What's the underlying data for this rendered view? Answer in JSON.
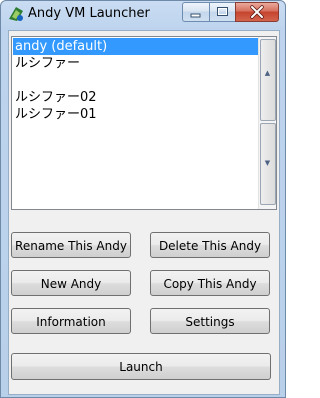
{
  "window": {
    "title": "Andy VM Launcher",
    "icon": "andy-app-icon"
  },
  "caption_buttons": {
    "minimize_icon": "minimize-icon",
    "maximize_icon": "maximize-icon",
    "close_icon": "close-icon"
  },
  "vm_list": {
    "items": [
      {
        "label": "andy (default)",
        "selected": true
      },
      {
        "label": "ルシファー",
        "selected": false
      },
      {
        "label": "",
        "selected": false
      },
      {
        "label": "ルシファー02",
        "selected": false
      },
      {
        "label": "ルシファー01",
        "selected": false
      }
    ]
  },
  "buttons": {
    "rename": "Rename This Andy",
    "delete": "Delete This Andy",
    "new": "New Andy",
    "copy": "Copy This Andy",
    "information": "Information",
    "settings": "Settings",
    "launch": "Launch"
  },
  "colors": {
    "selection": "#3399ff",
    "close_button": "#c5432d"
  }
}
